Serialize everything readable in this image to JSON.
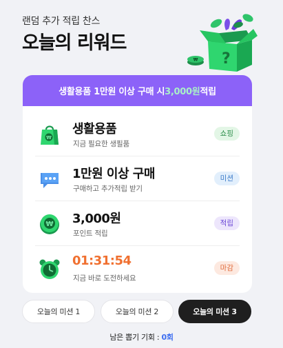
{
  "header": {
    "subtitle": "랜덤 추가 적립 찬스",
    "title": "오늘의 리워드"
  },
  "banner": {
    "prefix": "생활용품 1만원 이상 구매 시 ",
    "highlight": "3,000원",
    "suffix": " 적립",
    "colors": {
      "background": "#8c62f8",
      "highlight": "#a9f0c7"
    }
  },
  "rows": [
    {
      "icon": "shopping-bag-icon",
      "main": "생활용품",
      "sub": "지금 필요한 생필품",
      "badge": "쇼핑"
    },
    {
      "icon": "chat-bubble-icon",
      "main": "1만원 이상 구매",
      "sub": "구매하고 추가적립 받기",
      "badge": "미션"
    },
    {
      "icon": "coin-icon",
      "main": "3,000원",
      "sub": "포인트 적립",
      "badge": "적립"
    },
    {
      "icon": "alarm-clock-icon",
      "main": "01:31:54",
      "sub": "지금 바로 도전하세요",
      "badge": "마감"
    }
  ],
  "tabs": [
    {
      "label": "오늘의 미션 1"
    },
    {
      "label": "오늘의 미션 2"
    },
    {
      "label": "오늘의 미션 3",
      "active": true
    }
  ],
  "remaining": {
    "label": "남은 뽑기 기회 : ",
    "count": "0회"
  }
}
